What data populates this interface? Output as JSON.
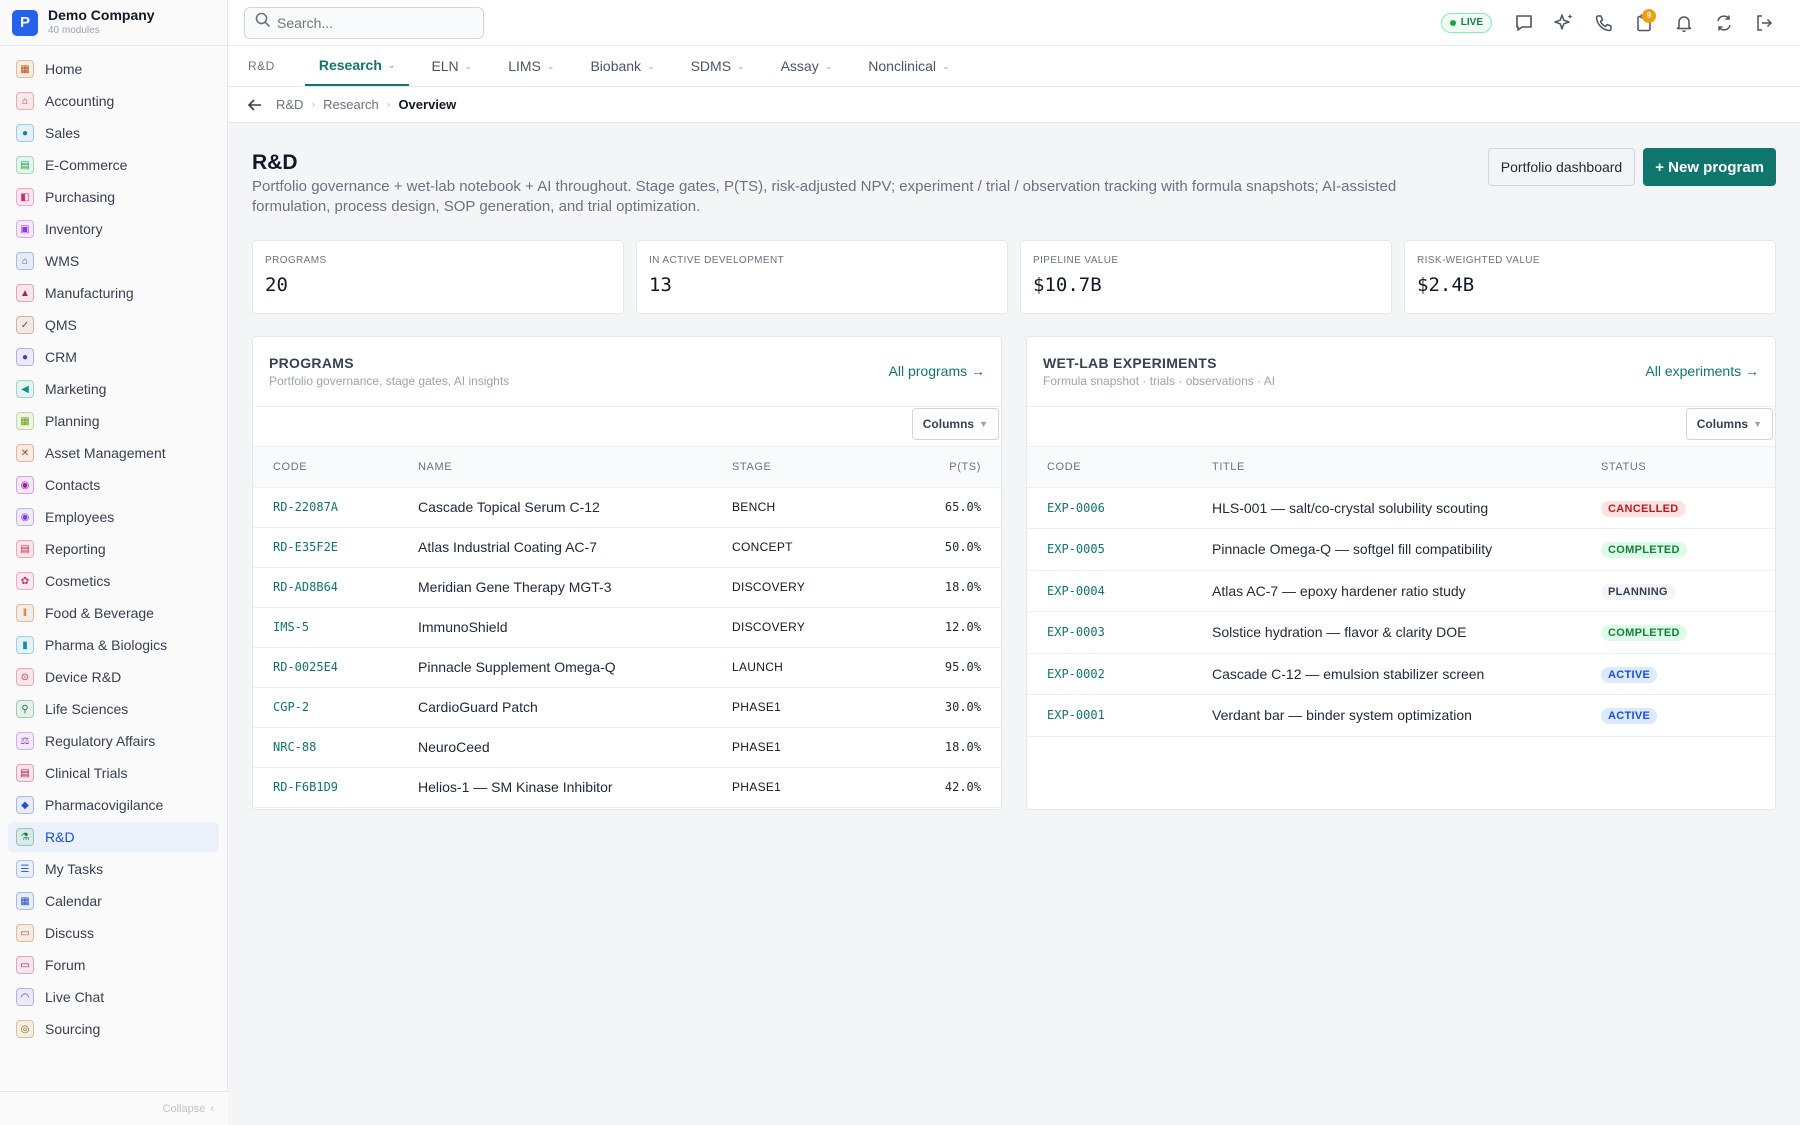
{
  "brand": {
    "logo_letter": "P",
    "name": "Demo Company",
    "subtitle": "40 modules"
  },
  "sidebar": {
    "items": [
      {
        "label": "Home",
        "icon": "grid-icon",
        "color": "#b45309"
      },
      {
        "label": "Accounting",
        "icon": "bank-icon",
        "color": "#dc2626"
      },
      {
        "label": "Sales",
        "icon": "person-icon",
        "color": "#0284c7"
      },
      {
        "label": "E-Commerce",
        "icon": "store-icon",
        "color": "#16a34a"
      },
      {
        "label": "Purchasing",
        "icon": "cart-icon",
        "color": "#db2777"
      },
      {
        "label": "Inventory",
        "icon": "box-icon",
        "color": "#9333ea"
      },
      {
        "label": "WMS",
        "icon": "warehouse-icon",
        "color": "#1d4ed8"
      },
      {
        "label": "Manufacturing",
        "icon": "factory-icon",
        "color": "#be185d"
      },
      {
        "label": "QMS",
        "icon": "badge-check-icon",
        "color": "#92400e"
      },
      {
        "label": "CRM",
        "icon": "users-icon",
        "color": "#4338ca"
      },
      {
        "label": "Marketing",
        "icon": "megaphone-icon",
        "color": "#0d9488"
      },
      {
        "label": "Planning",
        "icon": "calendar-grid-icon",
        "color": "#65a30d"
      },
      {
        "label": "Asset Management",
        "icon": "tools-icon",
        "color": "#c2410c"
      },
      {
        "label": "Contacts",
        "icon": "contact-icon",
        "color": "#a21caf"
      },
      {
        "label": "Employees",
        "icon": "employee-icon",
        "color": "#7c3aed"
      },
      {
        "label": "Reporting",
        "icon": "report-icon",
        "color": "#e11d48"
      },
      {
        "label": "Cosmetics",
        "icon": "flower-icon",
        "color": "#db2777"
      },
      {
        "label": "Food & Beverage",
        "icon": "utensils-icon",
        "color": "#b45309"
      },
      {
        "label": "Pharma & Biologics",
        "icon": "pill-icon",
        "color": "#0891b2"
      },
      {
        "label": "Device R&D",
        "icon": "device-icon",
        "color": "#e11d48"
      },
      {
        "label": "Life Sciences",
        "icon": "microscope-icon",
        "color": "#15803d"
      },
      {
        "label": "Regulatory Affairs",
        "icon": "gavel-icon",
        "color": "#9333ea"
      },
      {
        "label": "Clinical Trials",
        "icon": "clipboard-icon",
        "color": "#be123c"
      },
      {
        "label": "Pharmacovigilance",
        "icon": "shield-icon",
        "color": "#1d4ed8"
      },
      {
        "label": "R&D",
        "icon": "flask-icon",
        "color": "#15803d",
        "active": true
      },
      {
        "label": "My Tasks",
        "icon": "checklist-icon",
        "color": "#2563eb"
      },
      {
        "label": "Calendar",
        "icon": "calendar-icon",
        "color": "#1d4ed8"
      },
      {
        "label": "Discuss",
        "icon": "chat-icon",
        "color": "#b45309"
      },
      {
        "label": "Forum",
        "icon": "forum-icon",
        "color": "#be185d"
      },
      {
        "label": "Live Chat",
        "icon": "headset-icon",
        "color": "#4338ca"
      },
      {
        "label": "Sourcing",
        "icon": "sourcing-icon",
        "color": "#a16207"
      }
    ],
    "collapse_label": "Collapse"
  },
  "topbar": {
    "search_placeholder": "Search...",
    "live_label": "LIVE",
    "notification_count": "9"
  },
  "tabs": {
    "root": "R&D",
    "items": [
      "Research",
      "ELN",
      "LIMS",
      "Biobank",
      "SDMS",
      "Assay",
      "Nonclinical"
    ],
    "active": "Research"
  },
  "breadcrumb": [
    "R&D",
    "Research",
    "Overview"
  ],
  "page": {
    "title": "R&D",
    "description": "Portfolio governance + wet-lab notebook + AI throughout. Stage gates, P(TS), risk-adjusted NPV; experiment / trial / observation tracking with formula snapshots; AI-assisted formulation, process design, SOP generation, and trial optimization.",
    "btn_dashboard": "Portfolio dashboard",
    "btn_new": "+ New program"
  },
  "kpis": [
    {
      "label": "PROGRAMS",
      "value": "20"
    },
    {
      "label": "IN ACTIVE DEVELOPMENT",
      "value": "13"
    },
    {
      "label": "PIPELINE VALUE",
      "value": "$10.7B"
    },
    {
      "label": "RISK-WEIGHTED VALUE",
      "value": "$2.4B"
    }
  ],
  "programs": {
    "title": "PROGRAMS",
    "subtitle": "Portfolio governance, stage gates, AI insights",
    "link": "All programs →",
    "columns_btn": "Columns",
    "headers": [
      "CODE",
      "NAME",
      "STAGE",
      "P(TS)"
    ],
    "rows": [
      {
        "code": "RD-22087A",
        "name": "Cascade Topical Serum C-12",
        "stage": "BENCH",
        "pts": "65.0%"
      },
      {
        "code": "RD-E35F2E",
        "name": "Atlas Industrial Coating AC-7",
        "stage": "CONCEPT",
        "pts": "50.0%"
      },
      {
        "code": "RD-AD8B64",
        "name": "Meridian Gene Therapy MGT-3",
        "stage": "DISCOVERY",
        "pts": "18.0%"
      },
      {
        "code": "IMS-5",
        "name": "ImmunoShield",
        "stage": "DISCOVERY",
        "pts": "12.0%"
      },
      {
        "code": "RD-0025E4",
        "name": "Pinnacle Supplement Omega-Q",
        "stage": "LAUNCH",
        "pts": "95.0%"
      },
      {
        "code": "CGP-2",
        "name": "CardioGuard Patch",
        "stage": "PHASE1",
        "pts": "30.0%"
      },
      {
        "code": "NRC-88",
        "name": "NeuroCeed",
        "stage": "PHASE1",
        "pts": "18.0%"
      },
      {
        "code": "RD-F6B1D9",
        "name": "Helios-1 — SM Kinase Inhibitor",
        "stage": "PHASE1",
        "pts": "42.0%"
      }
    ]
  },
  "experiments": {
    "title": "WET-LAB EXPERIMENTS",
    "subtitle": "Formula snapshot · trials · observations · AI",
    "link": "All experiments →",
    "columns_btn": "Columns",
    "headers": [
      "CODE",
      "TITLE",
      "STATUS"
    ],
    "rows": [
      {
        "code": "EXP-0006",
        "title": "HLS-001 — salt/co-crystal solubility scouting",
        "status": "CANCELLED",
        "status_color": "#b91c1c",
        "status_bg": "#fee2e2"
      },
      {
        "code": "EXP-0005",
        "title": "Pinnacle Omega-Q — softgel fill compatibility",
        "status": "COMPLETED",
        "status_color": "#15803d",
        "status_bg": "#dcfce7"
      },
      {
        "code": "EXP-0004",
        "title": "Atlas AC-7 — epoxy hardener ratio study",
        "status": "PLANNING",
        "status_color": "#374151",
        "status_bg": "#f3f4f6"
      },
      {
        "code": "EXP-0003",
        "title": "Solstice hydration — flavor & clarity DOE",
        "status": "COMPLETED",
        "status_color": "#15803d",
        "status_bg": "#dcfce7"
      },
      {
        "code": "EXP-0002",
        "title": "Cascade C-12 — emulsion stabilizer screen",
        "status": "ACTIVE",
        "status_color": "#1d4ed8",
        "status_bg": "#dbeafe"
      },
      {
        "code": "EXP-0001",
        "title": "Verdant bar — binder system optimization",
        "status": "ACTIVE",
        "status_color": "#1d4ed8",
        "status_bg": "#dbeafe"
      }
    ]
  }
}
